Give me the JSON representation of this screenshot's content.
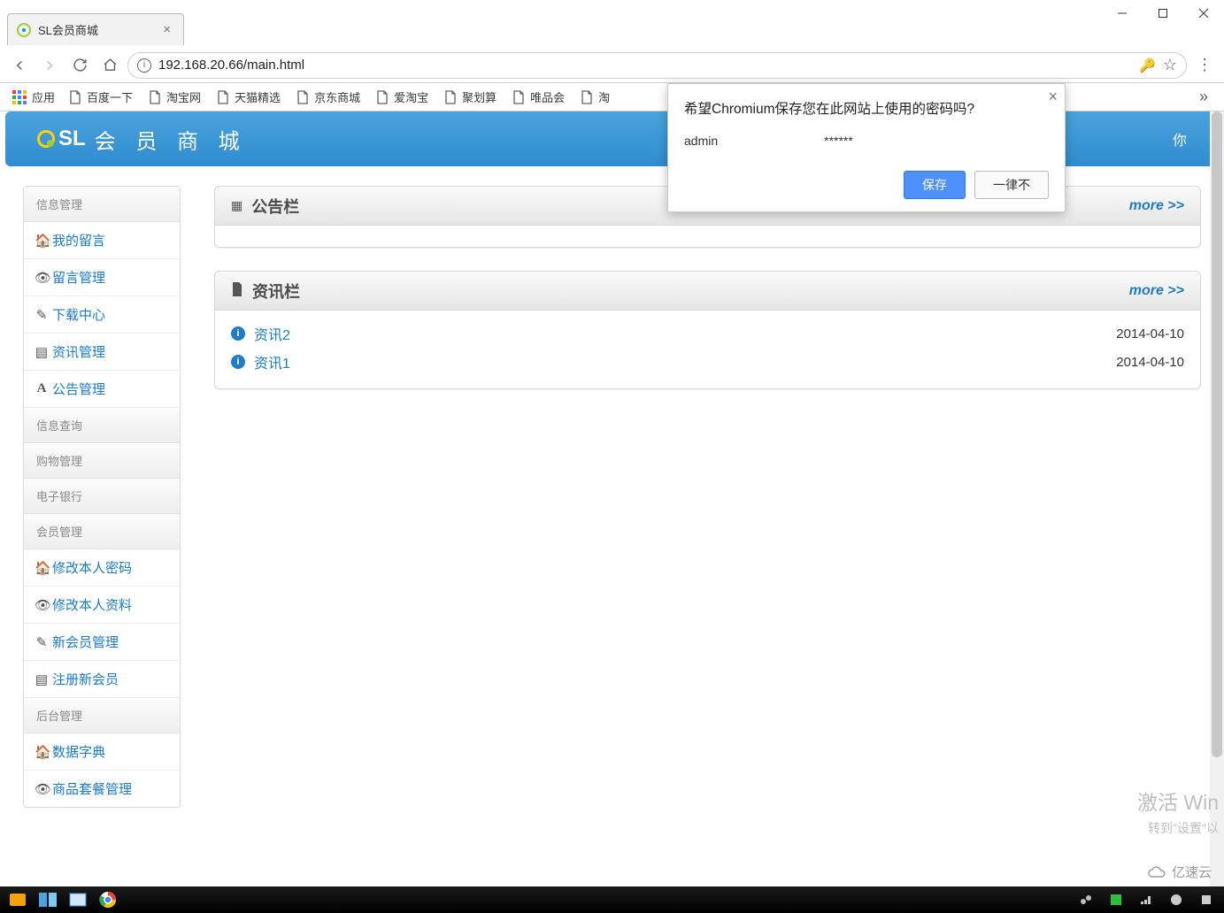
{
  "window": {
    "tab_title": "SL会员商城",
    "url": "192.168.20.66/main.html"
  },
  "bookmarks": {
    "apps_label": "应用",
    "items": [
      "百度一下",
      "淘宝网",
      "天猫精选",
      "京东商城",
      "爱淘宝",
      "聚划算",
      "唯品会",
      "淘"
    ]
  },
  "header": {
    "brand_sl": "SL",
    "brand_rest": "会 员 商 城",
    "right_text": "你"
  },
  "sidebar": {
    "groups": [
      {
        "title": "信息管理",
        "items": [
          {
            "icon": "home",
            "label": "我的留言"
          },
          {
            "icon": "eye",
            "label": "留言管理"
          },
          {
            "icon": "edit",
            "label": "下载中心"
          },
          {
            "icon": "list",
            "label": "资讯管理"
          },
          {
            "icon": "font",
            "label": "公告管理"
          }
        ]
      },
      {
        "title": "信息查询",
        "items": []
      },
      {
        "title": "购物管理",
        "items": []
      },
      {
        "title": "电子银行",
        "items": []
      },
      {
        "title": "会员管理",
        "items": [
          {
            "icon": "home",
            "label": "修改本人密码"
          },
          {
            "icon": "eye",
            "label": "修改本人资料"
          },
          {
            "icon": "edit",
            "label": "新会员管理"
          },
          {
            "icon": "list",
            "label": "注册新会员"
          }
        ]
      },
      {
        "title": "后台管理",
        "items": [
          {
            "icon": "home",
            "label": "数据字典"
          },
          {
            "icon": "eye",
            "label": "商品套餐管理"
          }
        ]
      }
    ]
  },
  "panels": {
    "notice": {
      "title": "公告栏",
      "more": "more >>"
    },
    "news": {
      "title": "资讯栏",
      "more": "more >>",
      "rows": [
        {
          "title": "资讯2",
          "date": "2014-04-10"
        },
        {
          "title": "资讯1",
          "date": "2014-04-10"
        }
      ]
    }
  },
  "save_popup": {
    "message": "希望Chromium保存您在此网站上使用的密码吗?",
    "username": "admin",
    "password_mask": "******",
    "save": "保存",
    "never": "一律不"
  },
  "watermark": {
    "line1": "激活 Win",
    "line2": "转到\"设置\"以",
    "cloud": "亿速云"
  }
}
